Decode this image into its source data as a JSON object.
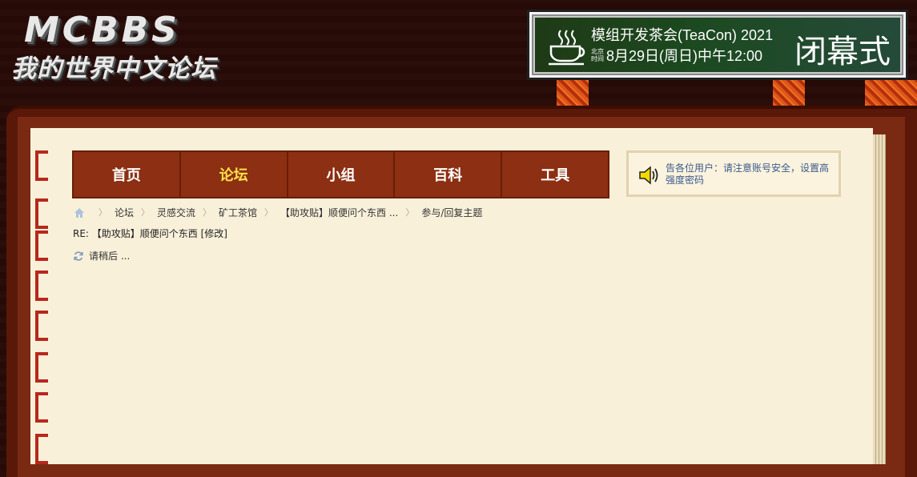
{
  "logo": {
    "main": "MCBBS",
    "sub": "我的世界中文论坛"
  },
  "banner": {
    "title": "模组开发茶会(TeaCon) 2021",
    "beijing_line1": "北京",
    "beijing_line2": "时间",
    "date": "8月29日(周日)中午12:00",
    "close_text": "闭幕式"
  },
  "nav": {
    "items": [
      {
        "label": "首页"
      },
      {
        "label": "论坛"
      },
      {
        "label": "小组"
      },
      {
        "label": "百科"
      },
      {
        "label": "工具"
      }
    ]
  },
  "notice": {
    "text": "告各位用户：请注意账号安全，设置高强度密码"
  },
  "breadcrumb": {
    "items": [
      {
        "label": "论坛"
      },
      {
        "label": "灵感交流"
      },
      {
        "label": "矿工茶馆"
      },
      {
        "label": "【助攻贴】顺便问个东西 ..."
      },
      {
        "label": "参与/回复主题"
      }
    ]
  },
  "post": {
    "reply_title": "RE: 【助攻贴】顺便问个东西 [修改]"
  },
  "status": {
    "loading": "请稍后 ..."
  },
  "colors": {
    "nav_bg": "#8c2f12",
    "nav_active": "#ffe14a",
    "page_bg": "#f9f0da",
    "notice_text": "#3a5a8c"
  }
}
